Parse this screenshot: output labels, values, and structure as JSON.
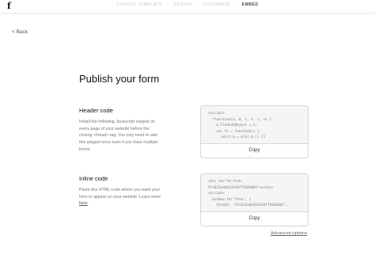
{
  "header": {
    "logo": "f",
    "steps": [
      {
        "label": "CHOOSE TEMPLATE",
        "active": false
      },
      {
        "label": "DESIGN",
        "active": false
      },
      {
        "label": "CUSTOMIZE",
        "active": false
      },
      {
        "label": "EMBED",
        "active": true
      }
    ],
    "separator": "›"
  },
  "nav": {
    "back_label": "< Back"
  },
  "page": {
    "title": "Publish your form"
  },
  "sections": {
    "header_code": {
      "title": "Header code",
      "description": "Install the following Javascript snippet on every page of your website before the closing </head> tag. You only need to add this snippet once even if you have multiple forms.",
      "code": "<script>\n  (function(w, d, t, h, s, n) {\n    w.FlodeskObject = n;\n    var fn = function() {\n      (w[n].q = w[n].q || []",
      "copy_label": "Copy"
    },
    "inline_code": {
      "title": "Inline code",
      "description_prefix": "Paste this HTML code where you want your form to appear on your website. Learn more ",
      "learn_more_link": "here",
      "description_suffix": ".",
      "code": "<div id=\"fd-form-\n5fc623add1b2b16f7926b6b5\"></div>\n<script>\n  window.fd('form', {\n    formId: '5fc623add1b2b16f7926b6b5',",
      "copy_label": "Copy"
    }
  },
  "footer": {
    "advanced_options": "Advanced options"
  }
}
